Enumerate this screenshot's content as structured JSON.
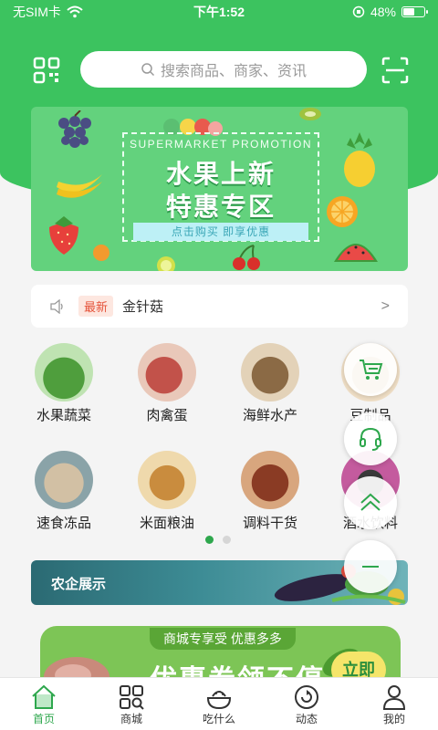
{
  "status_bar": {
    "carrier": "无SIM卡",
    "time": "下午1:52",
    "battery_text": "48%",
    "battery_level": 0.48
  },
  "search": {
    "placeholder": "搜索商品、商家、资讯"
  },
  "banner": {
    "english": "SUPERMARKET PROMOTION",
    "title_line1": "水果上新",
    "title_line2": "特惠专区",
    "cta": "点击购买 即享优惠"
  },
  "notice": {
    "badge": "最新",
    "text": "金针菇",
    "arrow": ">"
  },
  "categories": [
    {
      "label": "水果蔬菜",
      "color": "#7cc25b"
    },
    {
      "label": "肉禽蛋",
      "color": "#c86b5c"
    },
    {
      "label": "海鲜水产",
      "color": "#b08a56"
    },
    {
      "label": "豆制品",
      "color": "#d9b58a"
    },
    {
      "label": "速食冻品",
      "color": "#c9b79c"
    },
    {
      "label": "米面粮油",
      "color": "#d7a85b"
    },
    {
      "label": "调料干货",
      "color": "#9a5a3a"
    },
    {
      "label": "酒水饮料",
      "color": "#c45b9e"
    }
  ],
  "pager": {
    "pages": 2,
    "current": 0
  },
  "agri_banner": {
    "label": "农企展示"
  },
  "promo": {
    "title": "商城专享受 优惠多多",
    "big_text": "优惠券领不停",
    "button": "立即"
  },
  "tabs": [
    {
      "label": "首页",
      "icon": "home-icon",
      "active": true
    },
    {
      "label": "商城",
      "icon": "grid-search-icon",
      "active": false
    },
    {
      "label": "吃什么",
      "icon": "food-bowl-icon",
      "active": false
    },
    {
      "label": "动态",
      "icon": "refresh-icon",
      "active": false
    },
    {
      "label": "我的",
      "icon": "user-icon",
      "active": false
    }
  ],
  "colors": {
    "brand_green": "#3cc35f",
    "badge_red": "#e5533a"
  }
}
